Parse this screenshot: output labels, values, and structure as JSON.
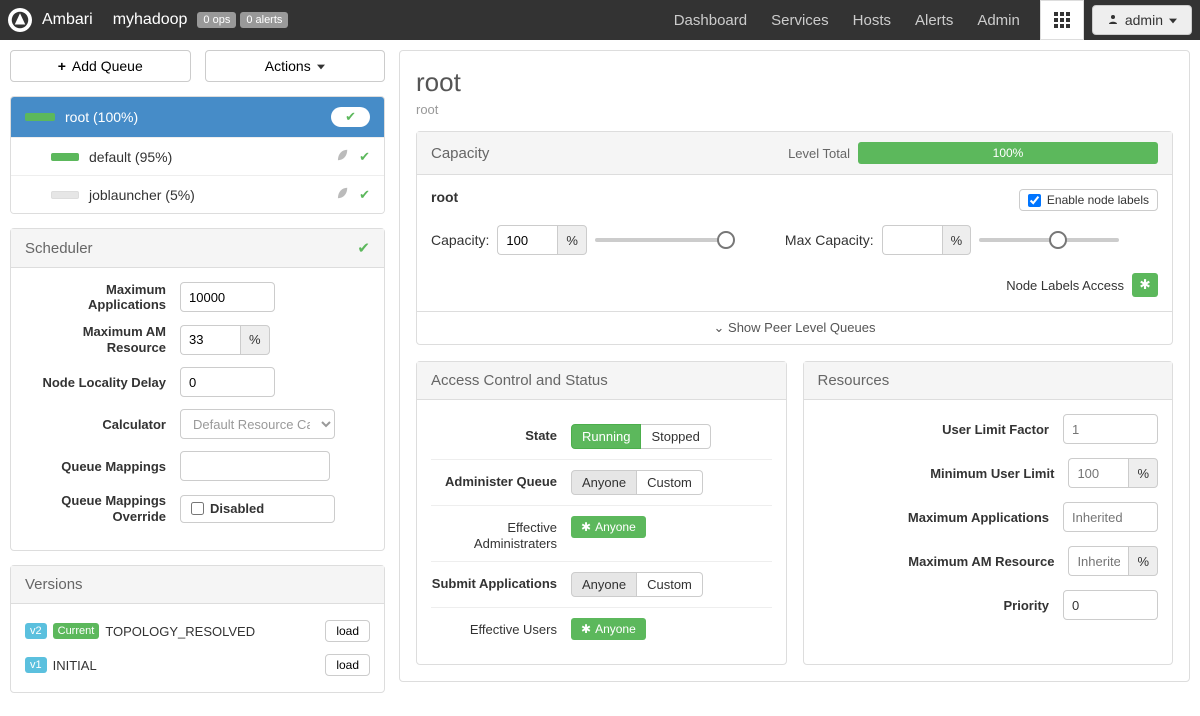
{
  "topnav": {
    "brand": "Ambari",
    "cluster": "myhadoop",
    "ops_badge": "0 ops",
    "alerts_badge": "0 alerts",
    "links": [
      "Dashboard",
      "Services",
      "Hosts",
      "Alerts",
      "Admin"
    ],
    "user_btn": "admin"
  },
  "sidebar": {
    "add_queue": "Add Queue",
    "actions": "Actions",
    "queues": [
      {
        "name": "root (100%)",
        "bar_pct": 100,
        "selected": true
      },
      {
        "name": "default (95%)",
        "bar_pct": 95,
        "selected": false
      },
      {
        "name": "joblauncher (5%)",
        "bar_pct": 5,
        "selected": false
      }
    ],
    "scheduler_title": "Scheduler",
    "scheduler": {
      "max_apps_label": "Maximum Applications",
      "max_apps": "10000",
      "max_am_label": "Maximum AM Resource",
      "max_am": "33",
      "pct": "%",
      "node_locality_label": "Node Locality Delay",
      "node_locality": "0",
      "calculator_label": "Calculator",
      "calculator": "Default Resource Cal",
      "queue_mappings_label": "Queue Mappings",
      "queue_mappings": "",
      "override_label": "Queue Mappings Override",
      "override_chk": "Disabled"
    },
    "versions_title": "Versions",
    "versions": [
      {
        "tag": "v2",
        "current": "Current",
        "name": "TOPOLOGY_RESOLVED",
        "btn": "load"
      },
      {
        "tag": "v1",
        "current": "",
        "name": "INITIAL",
        "btn": "load"
      }
    ]
  },
  "main": {
    "title": "root",
    "breadcrumb": "root",
    "capacity": {
      "head": "Capacity",
      "level_total_label": "Level Total",
      "level_total_pct": "100%",
      "root_label": "root",
      "enable_node_labels": "Enable node labels",
      "capacity_label": "Capacity:",
      "capacity_val": "100",
      "pct": "%",
      "max_capacity_label": "Max Capacity:",
      "max_capacity_val": "",
      "node_labels_access": "Node Labels Access",
      "show_peer": "Show Peer Level Queues"
    },
    "acl": {
      "head": "Access Control and Status",
      "state_label": "State",
      "running": "Running",
      "stopped": "Stopped",
      "admin_queue_label": "Administer Queue",
      "anyone": "Anyone",
      "custom": "Custom",
      "eff_admins_label": "Effective Administraters",
      "submit_label": "Submit Applications",
      "eff_users_label": "Effective Users",
      "tag_anyone": "Anyone"
    },
    "resources": {
      "head": "Resources",
      "user_limit_factor_label": "User Limit Factor",
      "user_limit_factor": "1",
      "min_user_limit_label": "Minimum User Limit",
      "min_user_limit": "100",
      "pct": "%",
      "max_apps_label": "Maximum Applications",
      "max_apps_ph": "Inherited",
      "max_am_label": "Maximum AM Resource",
      "max_am_ph": "Inherite",
      "priority_label": "Priority",
      "priority": "0"
    }
  }
}
